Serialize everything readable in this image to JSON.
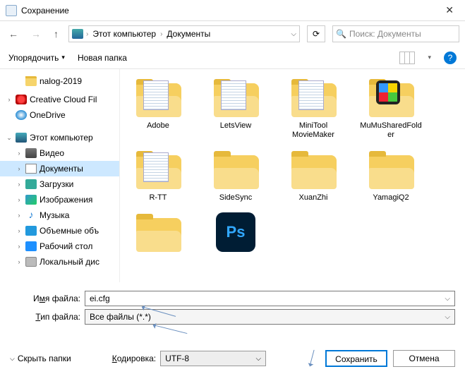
{
  "window": {
    "title": "Сохранение"
  },
  "nav": {
    "breadcrumb": [
      "Этот компьютер",
      "Документы"
    ],
    "search_placeholder": "Поиск: Документы"
  },
  "toolbar": {
    "organize": "Упорядочить",
    "new_folder": "Новая папка"
  },
  "tree": {
    "items": [
      {
        "label": "nalog-2019",
        "icon": "folder",
        "indent": 1
      },
      {
        "label": "Creative Cloud Fil",
        "icon": "cc",
        "chev": ">",
        "indent": 0
      },
      {
        "label": "OneDrive",
        "icon": "od",
        "indent": 0
      },
      {
        "label": "Этот компьютер",
        "icon": "pc",
        "chev": "v",
        "indent": 0,
        "bold": false
      },
      {
        "label": "Видео",
        "icon": "vid",
        "chev": ">",
        "indent": 1
      },
      {
        "label": "Документы",
        "icon": "doc",
        "chev": ">",
        "indent": 1,
        "selected": true
      },
      {
        "label": "Загрузки",
        "icon": "dl",
        "chev": ">",
        "indent": 1
      },
      {
        "label": "Изображения",
        "icon": "img",
        "chev": ">",
        "indent": 1
      },
      {
        "label": "Музыка",
        "icon": "mus",
        "chev": ">",
        "indent": 1
      },
      {
        "label": "Объемные объ",
        "icon": "3d",
        "chev": ">",
        "indent": 1
      },
      {
        "label": "Рабочий стол",
        "icon": "desk",
        "chev": ">",
        "indent": 1
      },
      {
        "label": "Локальный дис",
        "icon": "disk",
        "chev": ">",
        "indent": 1
      }
    ]
  },
  "files": {
    "items": [
      {
        "name": "Adobe",
        "kind": "folder-docs"
      },
      {
        "name": "LetsView",
        "kind": "folder-docs"
      },
      {
        "name": "MiniTool MovieMaker",
        "kind": "folder-docs"
      },
      {
        "name": "MuMuSharedFolder",
        "kind": "folder-mumu"
      },
      {
        "name": "R-TT",
        "kind": "folder-docs"
      },
      {
        "name": "SideSync",
        "kind": "folder"
      },
      {
        "name": "XuanZhi",
        "kind": "folder"
      },
      {
        "name": "YamagiQ2",
        "kind": "folder"
      },
      {
        "name": "",
        "kind": "folder"
      },
      {
        "name": "",
        "kind": "ps"
      }
    ]
  },
  "form": {
    "filename_label_pre": "И",
    "filename_label_u": "м",
    "filename_label_post": "я файла:",
    "filename_value": "ei.cfg",
    "filetype_label_pre": "",
    "filetype_label_u": "Т",
    "filetype_label_post": "ип файла:",
    "filetype_value": "Все файлы  (*.*)",
    "encoding_label_pre": "",
    "encoding_label_u": "К",
    "encoding_label_post": "одировка:",
    "encoding_value": "UTF-8",
    "hide_folders": "Скрыть папки",
    "save": "Сохранить",
    "cancel": "Отмена"
  }
}
